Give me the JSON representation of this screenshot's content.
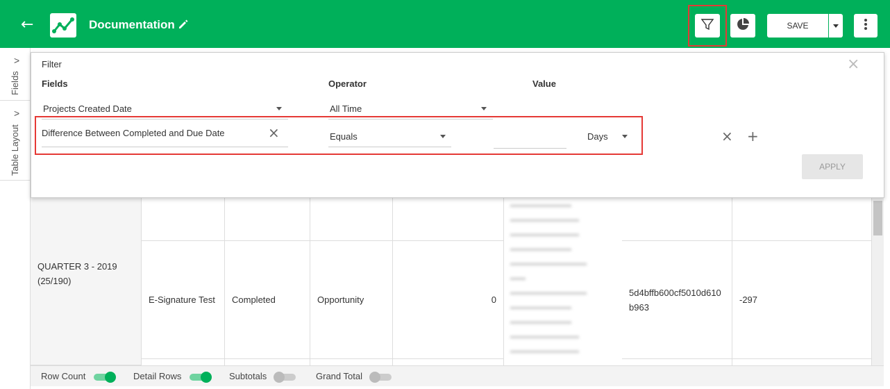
{
  "header": {
    "back_icon": "arrow-left-icon",
    "app_icon": "line-chart-icon",
    "title": "Documentation",
    "edit_icon": "pencil-icon",
    "filter_icon": "filter-icon",
    "chart_icon": "pie-chart-icon",
    "save_label": "SAVE",
    "more_icon": "more-vertical-icon",
    "brand_color": "#00b05a"
  },
  "sidebar": {
    "tabs": [
      {
        "label": "Fields"
      },
      {
        "label": "Table Layout"
      }
    ]
  },
  "filter_panel": {
    "title": "Filter",
    "col_fields": "Fields",
    "col_operator": "Operator",
    "col_value": "Value",
    "rows": [
      {
        "field": "Projects Created Date",
        "operator": "All Time"
      },
      {
        "field": "Difference Between Completed and Due Date",
        "operator": "Equals",
        "value": "",
        "unit": "Days"
      }
    ],
    "apply_label": "APPLY"
  },
  "table": {
    "group_label": "QUARTER 3 - 2019\n(25/190)",
    "row": {
      "name": "E-Signature Test",
      "status": "Completed",
      "type": "Opportunity",
      "amount": "0",
      "id": "5d4bffb600cf5010d610b963",
      "diff": "-297"
    }
  },
  "footer": {
    "row_count": "Row Count",
    "detail_rows": "Detail Rows",
    "subtotals": "Subtotals",
    "grand_total": "Grand Total",
    "toggles": {
      "row_count": true,
      "detail_rows": true,
      "subtotals": false,
      "grand_total": false
    }
  }
}
